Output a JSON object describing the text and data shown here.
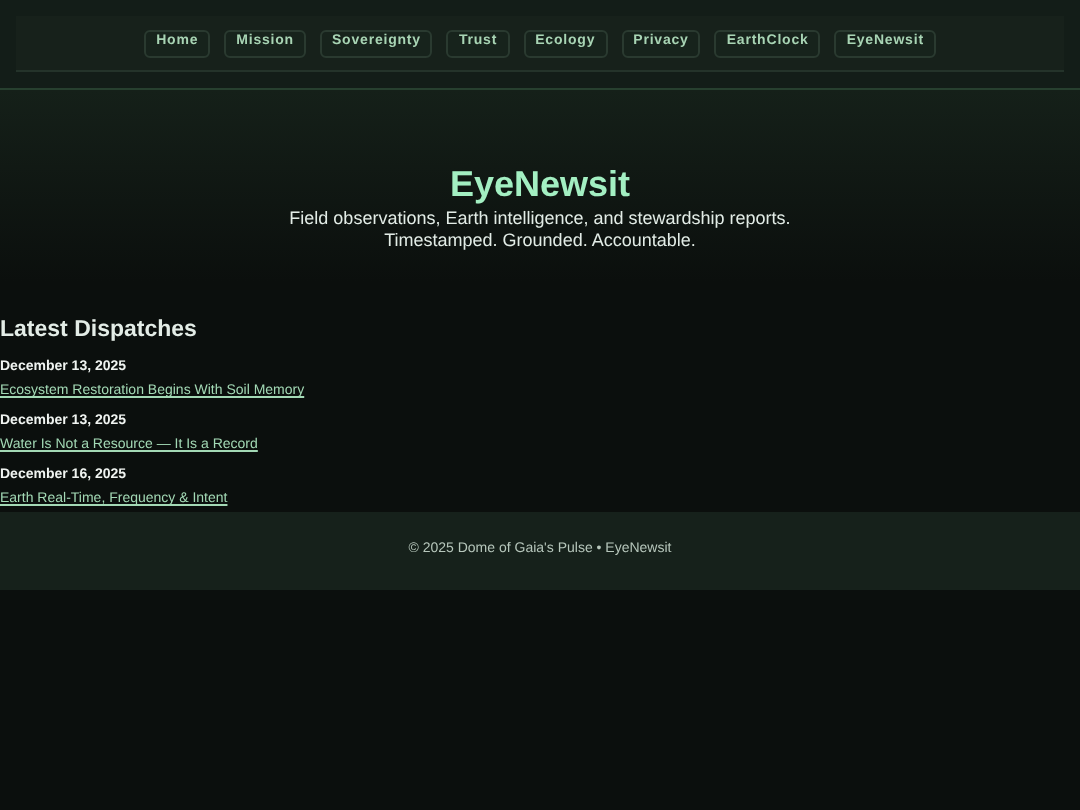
{
  "nav": {
    "items": [
      "Home",
      "Mission",
      "Sovereignty",
      "Trust",
      "Ecology",
      "Privacy",
      "EarthClock",
      "EyeNewsit"
    ]
  },
  "hero": {
    "title": "EyeNewsit",
    "subtitle_lines": [
      "Field observations, Earth intelligence, and stewardship reports.",
      "Timestamped. Grounded. Accountable."
    ]
  },
  "dispatches": {
    "heading": "Latest Dispatches",
    "items": [
      {
        "date": "December 13, 2025",
        "title": "Ecosystem Restoration Begins With Soil Memory"
      },
      {
        "date": "December 13, 2025",
        "title": "Water Is Not a Resource — It Is a Record"
      },
      {
        "date": "December 16, 2025",
        "title": "Earth Real-Time, Frequency & Intent"
      }
    ]
  },
  "footer": {
    "text": "© 2025 Dome of Gaia's Pulse • EyeNewsit"
  }
}
